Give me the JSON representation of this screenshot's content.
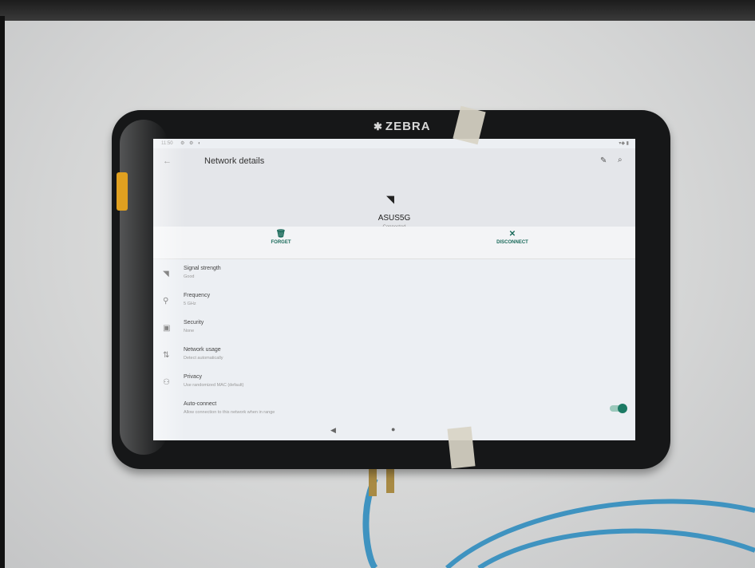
{
  "device": {
    "brand": "ZEBRA"
  },
  "status_bar": {
    "time": "11:50",
    "left_icons": "⚙ ⚙ ◐",
    "right_icons": "▾◆ ▮"
  },
  "header": {
    "title": "Network details",
    "network_name": "ASUS5G",
    "network_status": "Connected"
  },
  "actions": {
    "forget": "FORGET",
    "disconnect": "DISCONNECT"
  },
  "settings": [
    {
      "label": "Signal strength",
      "value": "Good"
    },
    {
      "label": "Frequency",
      "value": "5 GHz"
    },
    {
      "label": "Security",
      "value": "None"
    },
    {
      "label": "Network usage",
      "value": "Detect automatically"
    },
    {
      "label": "Privacy",
      "value": "Use randomized MAC (default)"
    },
    {
      "label": "Auto-connect",
      "value": "Allow connection to this network when in range"
    }
  ],
  "auto_connect_on": true,
  "colors": {
    "accent": "#1c7a64",
    "cable": "#3f93c0"
  }
}
